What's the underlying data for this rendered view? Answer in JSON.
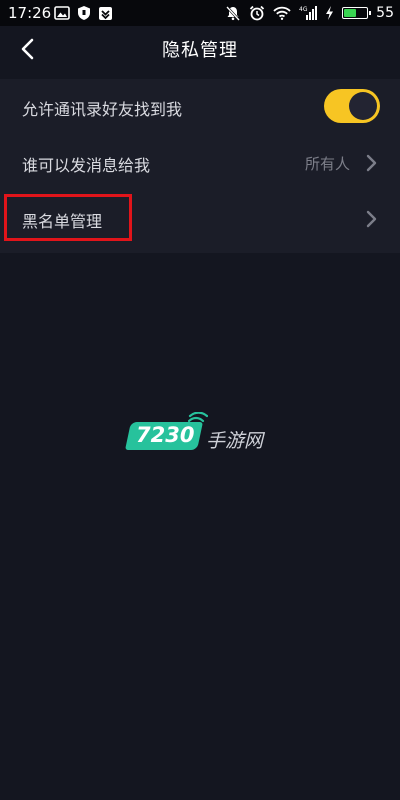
{
  "status_bar": {
    "time": "17:26",
    "battery_level": "55",
    "battery_fraction": 0.55,
    "network_label": "4G",
    "left_icons": [
      "image-icon",
      "shield-icon",
      "download-box-icon"
    ],
    "right_icons": [
      "mute-icon",
      "alarm-icon",
      "wifi-icon",
      "cell-signal-icon",
      "charging-icon",
      "battery-icon"
    ]
  },
  "header": {
    "back_icon": "chevron-left-icon",
    "title": "隐私管理"
  },
  "settings": {
    "items": [
      {
        "label": "允许通讯录好友找到我",
        "control": "toggle",
        "toggle_on": true
      },
      {
        "label": "谁可以发消息给我",
        "value": "所有人",
        "control": "chevron"
      },
      {
        "label": "黑名单管理",
        "control": "chevron",
        "highlighted": true
      }
    ]
  },
  "watermark": {
    "number": "7230",
    "text": "手游网"
  },
  "colors": {
    "background": "#141620",
    "status_bar": "#07080c",
    "list_background": "#1b1d28",
    "toggle_on": "#f7c523",
    "highlight": "#e1141a",
    "watermark_green": "#27c29c",
    "battery_green": "#39d451"
  }
}
